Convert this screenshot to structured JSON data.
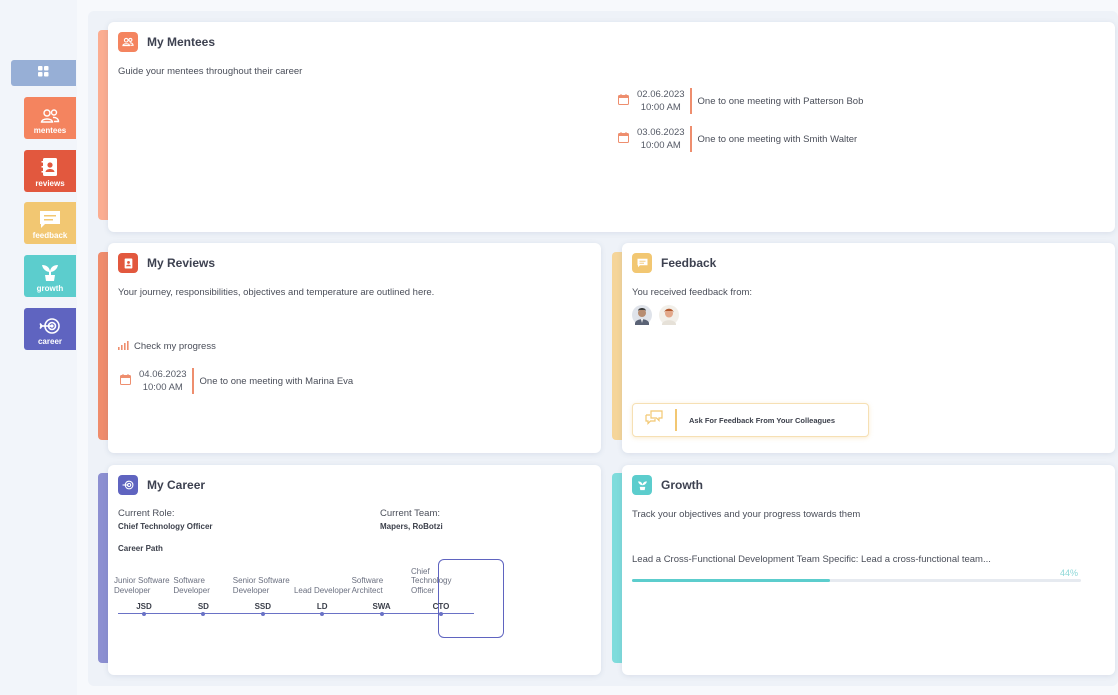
{
  "sidebar": {
    "home": {
      "icon": "grid-icon"
    },
    "items": [
      {
        "label": "mentees",
        "icon": "users-icon",
        "color": "#f4845f"
      },
      {
        "label": "reviews",
        "icon": "contact-book-icon",
        "color": "#e2583e"
      },
      {
        "label": "feedback",
        "icon": "message-icon",
        "color": "#f2c772"
      },
      {
        "label": "growth",
        "icon": "sprout-icon",
        "color": "#5ccdcd"
      },
      {
        "label": "career",
        "icon": "target-icon",
        "color": "#5f64c0"
      }
    ]
  },
  "mentees": {
    "title": "My Mentees",
    "subtitle": "Guide your mentees throughout their career",
    "meetings": [
      {
        "date": "02.06.2023",
        "time": "10:00 AM",
        "text": "One to one meeting with Patterson Bob"
      },
      {
        "date": "03.06.2023",
        "time": "10:00 AM",
        "text": "One to one meeting with Smith Walter"
      }
    ]
  },
  "reviews": {
    "title": "My Reviews",
    "subtitle": "Your journey, responsibilities, objectives and temperature are outlined here.",
    "progress_link": "Check my progress",
    "meeting": {
      "date": "04.06.2023",
      "time": "10:00 AM",
      "text": "One to one meeting with Marina Eva"
    }
  },
  "feedback": {
    "title": "Feedback",
    "subtitle": "You received feedback from:",
    "ask_button": "Ask For Feedback From Your Colleagues"
  },
  "career": {
    "title": "My Career",
    "current_role_label": "Current Role:",
    "current_role": "Chief Technology Officer",
    "current_team_label": "Current Team:",
    "current_team": "Mapers, RoBotzi",
    "path_label": "Career Path",
    "path": [
      {
        "name": "Junior Software Developer",
        "abbr": "JSD"
      },
      {
        "name": "Software Developer",
        "abbr": "SD"
      },
      {
        "name": "Senior Software Developer",
        "abbr": "SSD"
      },
      {
        "name": "Lead Developer",
        "abbr": "LD"
      },
      {
        "name": "Software Architect",
        "abbr": "SWA"
      },
      {
        "name": "Chief Technology Officer",
        "abbr": "CTO"
      }
    ],
    "current_index": 5
  },
  "growth": {
    "title": "Growth",
    "subtitle": "Track your objectives and your progress towards them",
    "objective": "Lead a Cross-Functional Development Team Specific: Lead a cross-functional team...",
    "progress_label": "44%",
    "progress": 0.44
  },
  "colors": {
    "mentees": "#f4845f",
    "reviews": "#e2583e",
    "feedback": "#f2c772",
    "growth": "#5ccdcd",
    "career": "#5f64c0"
  }
}
